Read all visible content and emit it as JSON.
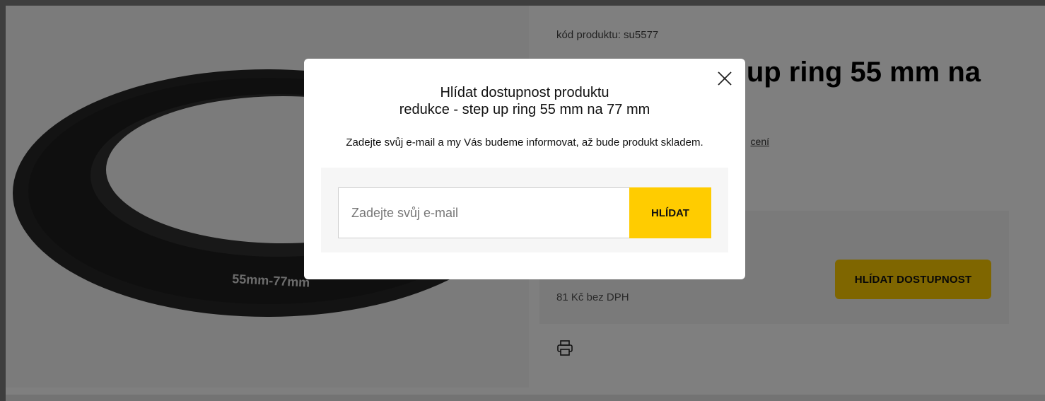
{
  "product": {
    "code_text": "kód produktu: su5577",
    "title_visible": "p up ring 55 mm na",
    "rating_link_fragment": "cení",
    "price_no_vat": "81 Kč bez DPH",
    "image_ring_label": "55mm-77mm",
    "watch_availability_label": "HLÍDAT DOSTUPNOST"
  },
  "modal": {
    "title_line1": "Hlídat dostupnost produktu",
    "title_line2": "redukce - step up ring 55 mm na 77 mm",
    "description": "Zadejte svůj e-mail a my Vás budeme informovat, až bude produkt skladem.",
    "email_placeholder": "Zadejte svůj e-mail",
    "email_value": "",
    "submit_label": "HLÍDAT"
  },
  "icons": {
    "close": "close-icon",
    "print": "print-icon"
  },
  "colors": {
    "accent": "#ffcc00",
    "overlay": "rgba(0,0,0,0.5)"
  }
}
